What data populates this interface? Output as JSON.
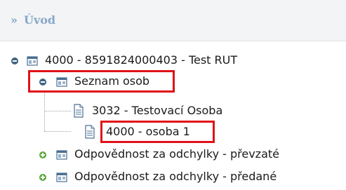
{
  "breadcrumb": {
    "separator": "»",
    "title": "Úvod"
  },
  "tree": {
    "root": {
      "label": "4000 - 8591824000403 - Test RUT",
      "state": "expanded"
    },
    "seznam": {
      "label": "Seznam osob",
      "state": "expanded"
    },
    "osoba1": {
      "label": "3032 - Testovací Osoba"
    },
    "osoba2": {
      "label": "4000 - osoba 1"
    },
    "prevzate": {
      "label": "Odpovědnost za odchylky - převzaté",
      "state": "collapsed"
    },
    "predane": {
      "label": "Odpovědnost za odchylky - předané",
      "state": "collapsed"
    }
  },
  "colors": {
    "highlight": "#e01219",
    "breadcrumb": "#86a8c7",
    "expand_minus": "#3f6480",
    "expand_plus": "#5aa83a"
  }
}
